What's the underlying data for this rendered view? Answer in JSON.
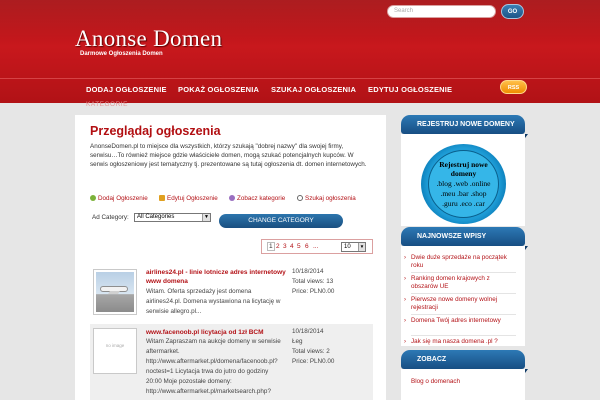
{
  "header": {
    "title": "Anonse Domen",
    "tagline": "Darmowe Ogłoszenia Domen",
    "search_placeholder": "Search",
    "go_label": "GO",
    "rss_label": "RSS"
  },
  "nav": {
    "items": [
      "DODAJ OGŁOSZENIE",
      "POKAŻ OGŁOSZENIA",
      "SZUKAJ OGŁOSZENIA",
      "EDYTUJ OGŁOSZENIE"
    ],
    "sub_label": "KATEGORIE"
  },
  "main": {
    "title": "Przeglądaj ogłoszenia",
    "intro": "AnonseDomen.pl to miejsce dla wszystkich, którzy szukają \"dobrej nazwy\" dla swojej firmy, serwisu…To również miejsce gdzie właściciele domen, mogą szukać potencjalnych kupców. W serwis ogłoszeniowy jest tematyczny tj. prezentowane są tutaj ogłoszenia dt. domen internetowych.",
    "actions": [
      "Dodaj Ogłoszenie",
      "Edytuj Ogłoszenie",
      "Zobacz kategorie",
      "Szukaj ogłoszenia"
    ],
    "category_label": "Ad Category:",
    "category_selected": "All Categories",
    "change_button": "CHANGE CATEGORY",
    "pager": {
      "pages": [
        "1",
        "2",
        "3",
        "4",
        "5",
        "6",
        "..."
      ],
      "current": "1",
      "per_page": "10"
    },
    "listings": [
      {
        "title_line1": "airlines24.pl - linie lotnicze adres internetowy",
        "title_line2": "www domena",
        "desc_lines": [
          "Witam. Oferta sprzedaży jest domena",
          "airlines24.pl. Domena wystawiona na licytację w",
          "serwisie allegro.pl..."
        ],
        "thumb_caption": "www.AIRLINES24.PL",
        "date": "10/18/2014",
        "views": "Total views: 13",
        "price": "Price: PLN0.00"
      },
      {
        "title_line1": "www.facenoob.pl licytacja od 1zł BCM",
        "desc_lines": [
          "Witam Zapraszam na aukcje domeny w serwisie",
          "aftermarket.",
          "http://www.aftermarket.pl/domena/facenoob.pl?",
          "noctest=1 Licytacja trwa do jutro do godziny",
          "20:00 Moje pozostałe domeny:",
          "http://www.aftermarket.pl/marketsearch.php?"
        ],
        "thumb_caption": "no image",
        "date": "10/18/2014",
        "location": "Łeg",
        "views": "Total views: 2",
        "price": "Price: PLN0.00"
      }
    ]
  },
  "sidebar": {
    "register_header": "REJESTRUJ NOWE DOMENY",
    "badge_lines": [
      "Rejestruj nowe",
      "domeny",
      ".blog .web .online",
      ".meu .bar .shop",
      ".guru .eco .car"
    ],
    "news_header": "NAJNOWSZE WPISY",
    "news_items": [
      "Dwie duże sprzedaże na początek roku",
      "Ranking domen krajowych z obszarów UE",
      "Pierwsze nowe domeny wolnej rejestracji",
      "Domena Twój adres internetowy",
      "Jak się ma nasza domena .pl ?"
    ],
    "see_header": "ZOBACZ",
    "see_items": [
      "Blog o domenach"
    ]
  },
  "colors": {
    "header_red": "#b8141a",
    "link_red": "#b31217",
    "sidebar_blue": "#1f5f9a",
    "rss_orange": "#f5a000"
  }
}
